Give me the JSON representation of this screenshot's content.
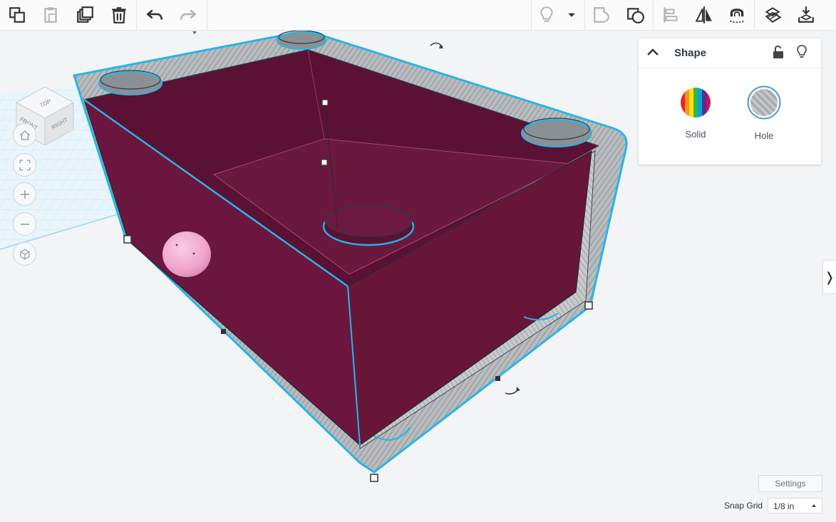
{
  "toolbar": {
    "left_buttons": [
      "copy-icon",
      "paste-icon",
      "duplicate-icon",
      "delete-icon",
      "undo-icon",
      "redo-icon"
    ],
    "right_buttons": [
      "bulb-icon",
      "dropdown-icon",
      "group-icon",
      "ungroup-icon",
      "align-icon",
      "mirror-icon",
      "cruise-icon",
      "workplane-icon",
      "import-icon"
    ]
  },
  "viewcube": {
    "faces": {
      "top": "TOP",
      "front": "FRONT",
      "right": "RIGHT"
    }
  },
  "nav": [
    "home-icon",
    "fit-view-icon",
    "zoom-in-icon",
    "zoom-out-icon",
    "perspective-icon"
  ],
  "inspector": {
    "title": "Shape",
    "options": [
      {
        "label": "Solid",
        "selected": false
      },
      {
        "label": "Hole",
        "selected": true
      }
    ]
  },
  "colors": {
    "accent": "#27b5e8",
    "shape_fill": "#6e1740",
    "hole_gray": "#a7abad",
    "sphere": "#f2a9cf",
    "workplane": "#bfe3f7"
  },
  "bottom": {
    "settings_label": "Settings",
    "snap_grid_label": "Snap Grid",
    "snap_grid_value": "1/8 in"
  }
}
